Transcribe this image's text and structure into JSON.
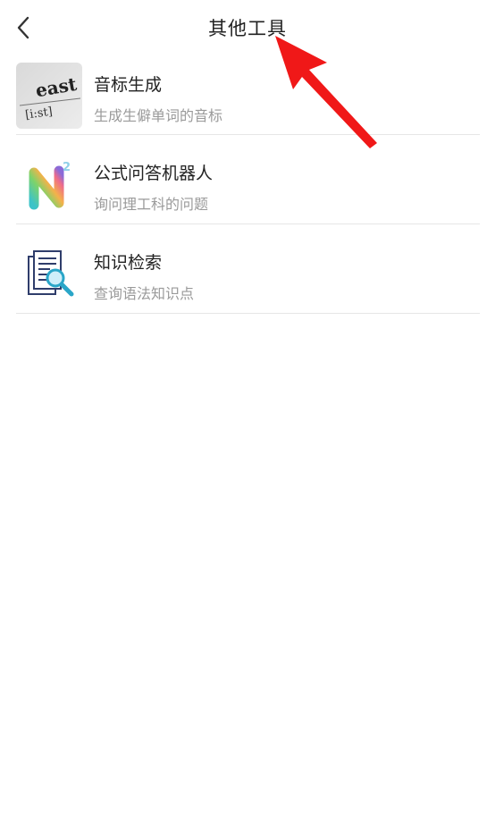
{
  "header": {
    "title": "其他工具",
    "back_icon": "chevron-left-icon"
  },
  "tools": [
    {
      "name": "音标生成",
      "desc": "生成生僻单词的音标",
      "icon": "east-phonetic-thumbnail",
      "thumb_word": "east",
      "thumb_phonetic": "[i:st]"
    },
    {
      "name": "公式问答机器人",
      "desc": "询问理工科的问题",
      "icon": "n-squared-logo",
      "thumb_mark": "N",
      "thumb_sup": "2"
    },
    {
      "name": "知识检索",
      "desc": "查询语法知识点",
      "icon": "document-search-icon"
    }
  ],
  "colors": {
    "arrow": "#f01818",
    "divider": "#e6e6e6",
    "subtitle": "#9a9a9a"
  }
}
